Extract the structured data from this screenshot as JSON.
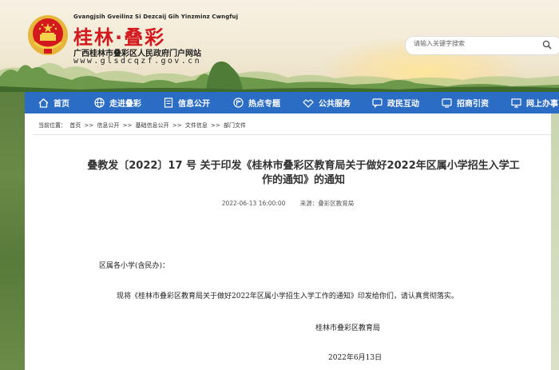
{
  "header": {
    "pinyin": "Gvangjsih Gveilinz Si Dezcaij Gih Yinzminz Cwngfuj",
    "site_name": "桂林·叠彩",
    "subtitle": "广西桂林市叠彩区人民政府门户网站",
    "domain": "www.glsdcqzf.gov.cn"
  },
  "search": {
    "placeholder": "请输入关键字搜索"
  },
  "nav": [
    {
      "label": "首页",
      "icon": "home-icon"
    },
    {
      "label": "走进叠彩",
      "icon": "globe-icon"
    },
    {
      "label": "信息公开",
      "icon": "document-icon"
    },
    {
      "label": "热点专题",
      "icon": "flag-icon"
    },
    {
      "label": "公共服务",
      "icon": "handshake-icon"
    },
    {
      "label": "政民互动",
      "icon": "chat-icon"
    },
    {
      "label": "招商引资",
      "icon": "screen-icon"
    },
    {
      "label": "网上办事",
      "icon": "computer-icon"
    }
  ],
  "breadcrumb": {
    "prefix": "当前位置：",
    "items": [
      "首页",
      "信息公开",
      "基础信息公开",
      "文件信息",
      "部门文件"
    ],
    "separator": ">>"
  },
  "article": {
    "title_line1": "叠教发〔2022〕17 号 关于印发《桂林市叠彩区教育局关于做好2022年区属小学招生入学工",
    "title_line2": "作的通知》的通知",
    "datetime": "2022-06-13 16:00:00",
    "source": "来源：叠彩区教育局",
    "salutation": "区属各小学(含民办)：",
    "body": "现将《桂林市叠彩区教育局关于做好2022年区属小学招生入学工作的通知》印发给你们，请认真贯彻落实。",
    "signature": "桂林市叠彩区教育局",
    "date": "2022年6月13日"
  },
  "colors": {
    "brand_red": "#d3181e",
    "nav_blue": "#2b6cc4"
  }
}
